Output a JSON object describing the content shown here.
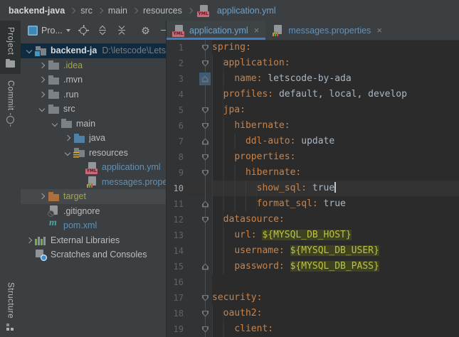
{
  "colors": {
    "accent_blue": "#3D7DC6",
    "panel_bg": "#3C3F41",
    "editor_bg": "#2B2B2B",
    "gutter_bg": "#313335",
    "selection_bg": "#0E2B42",
    "hover_bg": "#46494B",
    "caret_line_bg": "#323232",
    "yaml_key": "#CB8347",
    "yaml_value": "#A9B7C6",
    "env_text": "#BCC14A",
    "env_bg": "#3E421F",
    "ignored_file": "#A3A44F",
    "modified_file": "#6191B5",
    "line_number": "#606366"
  },
  "breadcrumb": {
    "items": [
      {
        "label": "backend-java"
      },
      {
        "label": "src"
      },
      {
        "label": "main"
      },
      {
        "label": "resources"
      },
      {
        "label": "application.yml",
        "icon": "yml-file-icon"
      }
    ]
  },
  "left_stripe": {
    "items": [
      {
        "label": "Project",
        "icon": "folder-icon",
        "active": true
      },
      {
        "label": "Commit",
        "icon": "commit-icon",
        "active": false
      },
      {
        "label": "Structure",
        "icon": "structure-icon",
        "active": false
      }
    ]
  },
  "project_panel": {
    "toolbar": {
      "view_label": "Pro...",
      "icons": [
        "locate-icon",
        "expand-all-icon",
        "collapse-all-icon",
        "settings-gear-icon",
        "hide-icon"
      ]
    },
    "tree": [
      {
        "id": "backend-java",
        "label": "backend-java",
        "extra": "D:\\letscode\\Lets",
        "level": 0,
        "chevron": "open",
        "icon": "project",
        "color": "root",
        "state": "selected"
      },
      {
        "id": "idea",
        "label": ".idea",
        "level": 1,
        "chevron": "closed",
        "icon": "folder",
        "color": "ignored"
      },
      {
        "id": "mvn",
        "label": ".mvn",
        "level": 1,
        "chevron": "closed",
        "icon": "folder",
        "color": "normal"
      },
      {
        "id": "run",
        "label": ".run",
        "level": 1,
        "chevron": "closed",
        "icon": "folder",
        "color": "normal"
      },
      {
        "id": "src",
        "label": "src",
        "level": 1,
        "chevron": "open",
        "icon": "folder",
        "color": "normal"
      },
      {
        "id": "main",
        "label": "main",
        "level": 2,
        "chevron": "open",
        "icon": "folder",
        "color": "normal"
      },
      {
        "id": "java",
        "label": "java",
        "level": 3,
        "chevron": "closed",
        "icon": "folder-java",
        "color": "normal"
      },
      {
        "id": "resources",
        "label": "resources",
        "level": 3,
        "chevron": "open",
        "icon": "folder-resources",
        "color": "normal"
      },
      {
        "id": "application-yml",
        "label": "application.yml",
        "level": 4,
        "chevron": "none",
        "icon": "yml",
        "color": "modified"
      },
      {
        "id": "messages-properties",
        "label": "messages.properties",
        "level": 4,
        "chevron": "none",
        "icon": "properties",
        "color": "modified"
      },
      {
        "id": "target",
        "label": "target",
        "level": 1,
        "chevron": "closed",
        "icon": "folder-excluded",
        "color": "ignored",
        "state": "hover"
      },
      {
        "id": "gitignore",
        "label": ".gitignore",
        "level": 1,
        "chevron": "none",
        "icon": "gitignore",
        "color": "normal"
      },
      {
        "id": "pom-xml",
        "label": "pom.xml",
        "level": 1,
        "chevron": "none",
        "icon": "maven",
        "color": "modified"
      },
      {
        "id": "external-libraries",
        "label": "External Libraries",
        "level": 0,
        "chevron": "closed",
        "icon": "libraries",
        "color": "normal"
      },
      {
        "id": "scratches",
        "label": "Scratches and Consoles",
        "level": 0,
        "chevron": "none",
        "icon": "scratches",
        "color": "normal"
      }
    ]
  },
  "editor": {
    "tabs": [
      {
        "label": "application.yml",
        "icon": "yml",
        "active": true
      },
      {
        "label": "messages.properties",
        "icon": "properties",
        "active": false
      }
    ],
    "lines": [
      {
        "n": 1,
        "indent": 0,
        "key": "spring:",
        "fold": "down"
      },
      {
        "n": 2,
        "indent": 2,
        "key": "application:",
        "fold": "down"
      },
      {
        "n": 3,
        "indent": 4,
        "key": "name:",
        "value": "letscode-by-ada",
        "fold": "up",
        "fold_boxed": true
      },
      {
        "n": 4,
        "indent": 2,
        "key": "profiles:",
        "value": "default, local, develop"
      },
      {
        "n": 5,
        "indent": 2,
        "key": "jpa:",
        "fold": "down"
      },
      {
        "n": 6,
        "indent": 4,
        "key": "hibernate:",
        "fold": "down"
      },
      {
        "n": 7,
        "indent": 6,
        "key": "ddl-auto:",
        "value": "update",
        "fold": "up"
      },
      {
        "n": 8,
        "indent": 4,
        "key": "properties:",
        "fold": "down"
      },
      {
        "n": 9,
        "indent": 6,
        "key": "hibernate:",
        "fold": "down"
      },
      {
        "n": 10,
        "indent": 8,
        "key": "show_sql:",
        "value": "true",
        "caret": true,
        "current": true
      },
      {
        "n": 11,
        "indent": 8,
        "key": "format_sql:",
        "value": "true",
        "fold": "up"
      },
      {
        "n": 12,
        "indent": 2,
        "key": "datasource:",
        "fold": "down"
      },
      {
        "n": 13,
        "indent": 4,
        "key": "url:",
        "value": "${MYSQL_DB_HOST}",
        "value_type": "env"
      },
      {
        "n": 14,
        "indent": 4,
        "key": "username:",
        "value": "${MYSQL_DB_USER}",
        "value_type": "env"
      },
      {
        "n": 15,
        "indent": 4,
        "key": "password:",
        "value": "${MYSQL_DB_PASS}",
        "value_type": "env",
        "fold": "up"
      },
      {
        "n": 16,
        "indent": 0
      },
      {
        "n": 17,
        "indent": 0,
        "key": "security:",
        "fold": "down"
      },
      {
        "n": 18,
        "indent": 2,
        "key": "oauth2:",
        "fold": "down"
      },
      {
        "n": 19,
        "indent": 4,
        "key": "client:",
        "fold": "down"
      }
    ]
  }
}
